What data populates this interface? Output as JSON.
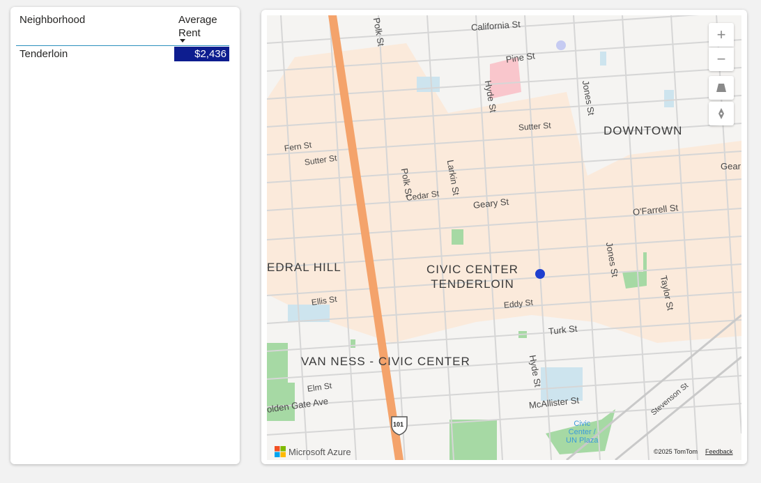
{
  "table": {
    "headers": {
      "neighborhood": "Neighborhood",
      "average_rent": "Average\nRent"
    },
    "rows": [
      {
        "neighborhood": "Tenderloin",
        "average_rent": "$2,436"
      }
    ]
  },
  "map": {
    "streets": [
      "Polk St",
      "California St",
      "Pine St",
      "Hyde St",
      "Jones St",
      "Sutter St",
      "Fern St",
      "Sutter St",
      "Polk St",
      "Larkin St",
      "Cedar St",
      "Geary St",
      "O'Farrell St",
      "Gear",
      "Jones St",
      "Taylor St",
      "Ellis St",
      "Eddy St",
      "Turk St",
      "Hyde St",
      "Elm St",
      "olden Gate Ave",
      "McAllister St",
      "Stevenson St"
    ],
    "neighborhoods": [
      "DOWNTOWN",
      "EDRAL HILL",
      "CIVIC CENTER\nTENDERLOIN",
      "VAN NESS - CIVIC CENTER"
    ],
    "poi": "Civic\nCenter /\nUN Plaza",
    "highway_shield": "101",
    "controls": {
      "zoom_in": "+",
      "zoom_out": "−"
    },
    "branding": "Microsoft Azure",
    "copyright": "©2025 TomTom",
    "feedback": "Feedback",
    "colors": {
      "primary_highway": "#f4a36b",
      "park": "#a6d9a4",
      "water": "#cde4ee",
      "dense_area": "#fbeadb",
      "marker": "#1f3fcf"
    }
  }
}
